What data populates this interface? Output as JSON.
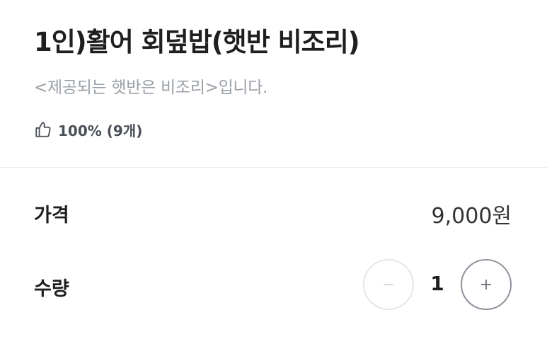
{
  "menu": {
    "title": "1인)활어 회덮밥(햇반 비조리)",
    "description": "<제공되는 햇반은 비조리>입니다.",
    "rating": "100% (9개)"
  },
  "price": {
    "label": "가격",
    "value": "9,000원"
  },
  "quantity": {
    "label": "수량",
    "value": "1",
    "decrease_symbol": "−",
    "increase_symbol": "+"
  },
  "icons": {
    "rating": "thumbs-up-icon"
  },
  "colors": {
    "text_primary": "#1f1f1f",
    "text_muted": "#9aa0a8",
    "divider": "#ececec",
    "stepper_disabled": "#e4e6e9",
    "stepper_enabled": "#8e949c"
  }
}
